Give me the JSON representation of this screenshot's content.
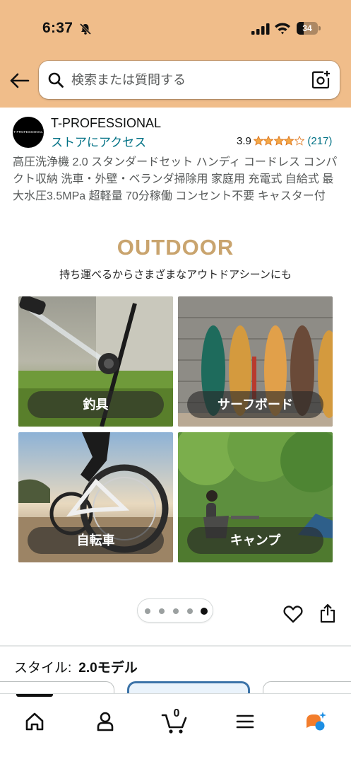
{
  "status_bar": {
    "time": "6:37",
    "battery": "34",
    "battery_level": 0.34
  },
  "search": {
    "placeholder": "検索または質問する"
  },
  "brand": {
    "logo_text": "T-PROFESSIONAL",
    "name": "T-PROFESSIONAL",
    "store_link": "ストアにアクセス",
    "rating": "3.9",
    "rating_value": 3.9,
    "rating_count": "(217)"
  },
  "product": {
    "title": "高圧洗浄機 2.0 スタンダードセット ハンディ コードレス コンパクト収納 洗車・外壁・ベランダ掃除用 家庭用 充電式 自給式 最大水圧3.5MPa 超軽量 70分稼働 コンセント不要 キャスター付"
  },
  "image": {
    "heading": "OUTDOOR",
    "subheading": "持ち運べるからさまざまなアウトドアシーンにも",
    "tiles": [
      {
        "label": "釣具"
      },
      {
        "label": "サーフボード"
      },
      {
        "label": "自転車"
      },
      {
        "label": "キャンプ"
      }
    ]
  },
  "carousel": {
    "count": 5,
    "active_index": 4
  },
  "style": {
    "label": "スタイル:",
    "value": "2.0モデル"
  },
  "nav": {
    "cart_count": "0",
    "items": [
      "home",
      "account",
      "cart",
      "menu",
      "rufus"
    ]
  },
  "colors": {
    "header_bg": "#F0BD8A",
    "link": "#007185",
    "star": "#F3A847",
    "outdoor_heading": "#C9A46E",
    "selected_chip": "#3C73A8"
  }
}
